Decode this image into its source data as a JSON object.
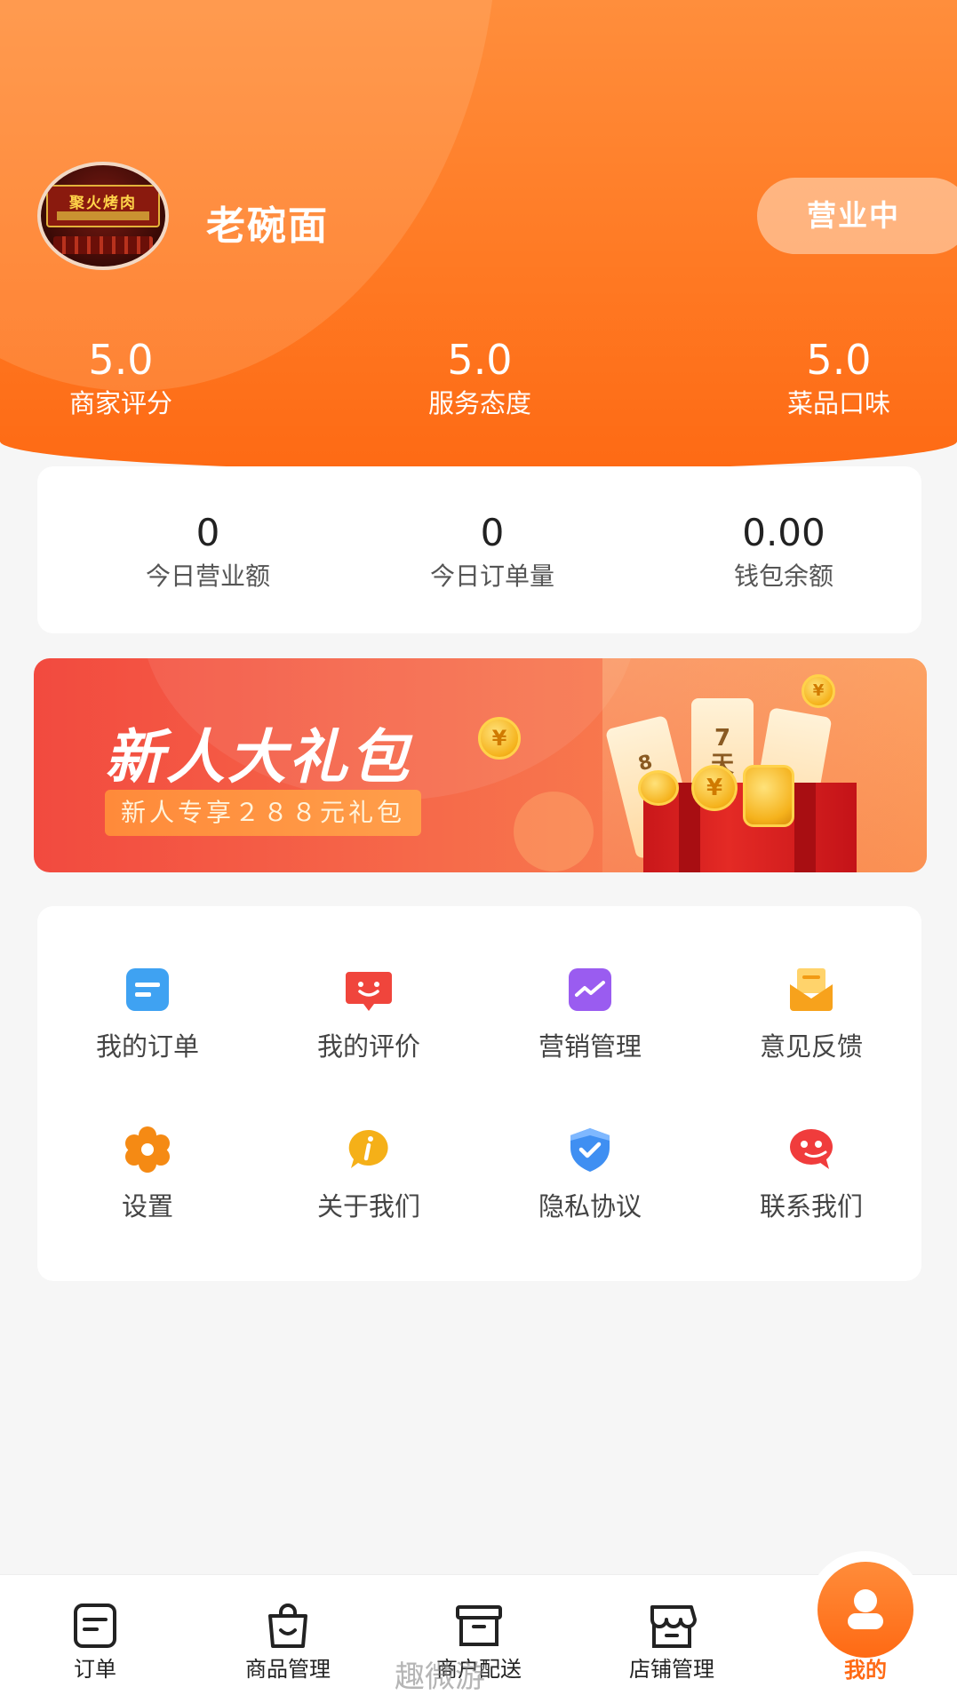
{
  "theme": {
    "accent": "#ff7a24",
    "accent_dark": "#fe6a14",
    "background": "#f6f6f6"
  },
  "store": {
    "avatar_sign": "聚火烤肉",
    "name": "老碗面",
    "status": "营业中"
  },
  "scores": [
    {
      "value": "5.0",
      "label": "商家评分"
    },
    {
      "value": "5.0",
      "label": "服务态度"
    },
    {
      "value": "5.0",
      "label": "菜品口味"
    }
  ],
  "stats": [
    {
      "value": "0",
      "label": "今日营业额"
    },
    {
      "value": "0",
      "label": "今日订单量"
    },
    {
      "value": "0.00",
      "label": "钱包余额"
    }
  ],
  "banner": {
    "title": "新人大礼包",
    "subtitle": "新人专享２８８元礼包",
    "ticket_1": "8折",
    "ticket_2": "7天"
  },
  "menu": [
    {
      "label": "我的订单",
      "icon": "order-doc-icon",
      "color": "#3fa2f2"
    },
    {
      "label": "我的评价",
      "icon": "smile-message-icon",
      "color": "#f0453c"
    },
    {
      "label": "营销管理",
      "icon": "trend-chart-icon",
      "color": "#9a5cf0"
    },
    {
      "label": "意见反馈",
      "icon": "envelope-icon",
      "color": "#f7a21c"
    },
    {
      "label": "设置",
      "icon": "gear-icon",
      "color": "#f58a14"
    },
    {
      "label": "关于我们",
      "icon": "info-bubble-icon",
      "color": "#f5b018"
    },
    {
      "label": "隐私协议",
      "icon": "shield-check-icon",
      "color": "#3f8ff2"
    },
    {
      "label": "联系我们",
      "icon": "chat-bubble-icon",
      "color": "#f03c3c"
    }
  ],
  "tabs": [
    {
      "label": "订单",
      "icon": "order-tab-icon"
    },
    {
      "label": "商品管理",
      "icon": "bag-tab-icon"
    },
    {
      "label": "商户配送",
      "icon": "box-tab-icon"
    },
    {
      "label": "店铺管理",
      "icon": "store-tab-icon"
    },
    {
      "label": "我的",
      "icon": "user-tab-icon",
      "active": true
    }
  ],
  "watermark": "趣微游"
}
